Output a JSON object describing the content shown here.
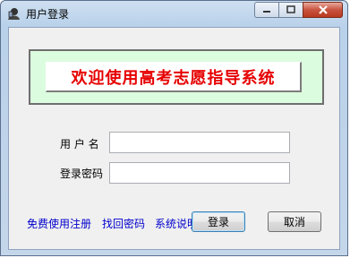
{
  "window": {
    "title": "用户登录"
  },
  "banner": {
    "text": "欢迎使用高考志愿指导系统",
    "color": "#e60000",
    "background": "#dcfcdf"
  },
  "form": {
    "username": {
      "label": "用 户 名",
      "value": ""
    },
    "password": {
      "label": "登录密码",
      "value": ""
    }
  },
  "links": {
    "register": "免费使用注册",
    "recover": "找回密码",
    "about": "系统说明"
  },
  "buttons": {
    "login": "登录",
    "cancel": "取消"
  },
  "icons": {
    "app": "login-app-icon",
    "minimize": "minimize-icon",
    "maximize": "maximize-icon",
    "close": "close-icon"
  }
}
